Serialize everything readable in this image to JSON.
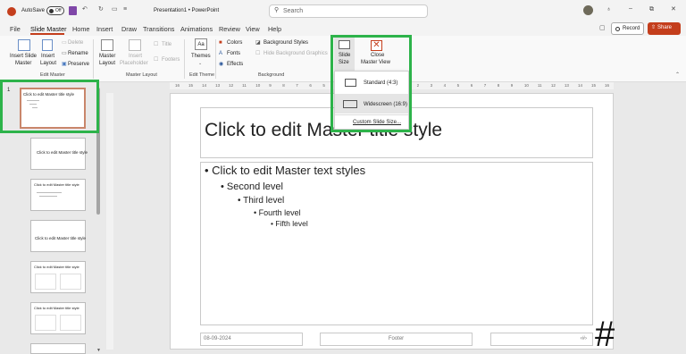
{
  "titlebar": {
    "autosave_label": "AutoSave",
    "toggle_state": "Off",
    "doc_title": "Presentation1 • PowerPoint",
    "search_placeholder": "Search"
  },
  "tabs": [
    "File",
    "Slide Master",
    "Home",
    "Insert",
    "Draw",
    "Transitions",
    "Animations",
    "Review",
    "View",
    "Help"
  ],
  "actions": {
    "record": "Record",
    "share": "Share"
  },
  "ribbon": {
    "insert_slide_master": [
      "Insert Slide",
      "Master"
    ],
    "insert_layout": [
      "Insert",
      "Layout"
    ],
    "delete": "Delete",
    "rename": "Rename",
    "preserve": "Preserve",
    "master_layout": [
      "Master",
      "Layout"
    ],
    "insert_placeholder": [
      "Insert",
      "Placeholder"
    ],
    "title_check": "Title",
    "footers_check": "Footers",
    "themes": "Themes",
    "colors": "Colors",
    "fonts": "Fonts",
    "effects": "Effects",
    "background_styles": "Background Styles",
    "hide_background_graphics": "Hide Background Graphics",
    "slide_size": [
      "Slide",
      "Size"
    ],
    "close_master_view": [
      "Close",
      "Master View"
    ],
    "groups": {
      "edit_master": "Edit Master",
      "master_layout": "Master Layout",
      "edit_theme": "Edit Theme",
      "background": "Background"
    }
  },
  "dropdown": {
    "items": [
      "Standard (4:3)",
      "Widescreen (16:9)"
    ],
    "custom": "Custom Slide Size..."
  },
  "thumbnails": {
    "index": "1",
    "master_title": "Click to edit Master title style",
    "layout_title": "Click to edit Master title style"
  },
  "ruler": {
    "marks": [
      "16",
      "15",
      "14",
      "13",
      "12",
      "11",
      "10",
      "9",
      "8",
      "7",
      "6",
      "5",
      "4",
      "3",
      "2",
      "1",
      "0",
      "1",
      "2",
      "3",
      "4",
      "5",
      "6",
      "7",
      "8",
      "9",
      "10",
      "11",
      "12",
      "13",
      "14",
      "15",
      "16"
    ]
  },
  "slide": {
    "title": "Click to edit Master title style",
    "levels": [
      "Click to edit Master text styles",
      "Second level",
      "Third level",
      "Fourth level",
      "Fifth level"
    ],
    "date": "08-09-2024",
    "footer": "Footer",
    "page_number": "‹#›"
  },
  "overlay_hash": "#",
  "colors": {
    "highlight_green": "#2db34a",
    "share_red": "#c43e1c",
    "accent_blue": "#2b579a"
  },
  "icons": [
    "powerpoint-logo-icon",
    "save-icon",
    "undo-icon",
    "redo-icon",
    "search-icon",
    "lightbulb-icon",
    "minimize-icon",
    "restore-icon",
    "close-icon",
    "comment-icon",
    "record-icon",
    "share-icon"
  ]
}
